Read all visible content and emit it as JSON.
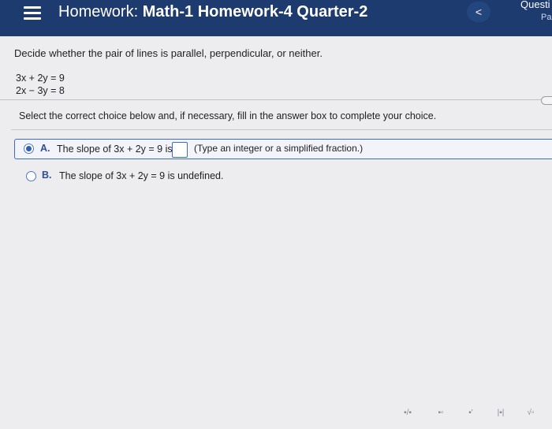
{
  "header": {
    "title_prefix": "Homework: ",
    "title_bold": "Math-1 Homework-4 Quarter-2",
    "back_label": "<",
    "question_label": "Questi",
    "question_sub": "Pa"
  },
  "problem": {
    "prompt": "Decide whether the pair of lines is parallel, perpendicular, or neither.",
    "equations": [
      "3x + 2y = 9",
      "2x − 3y = 8"
    ],
    "instruction": "Select the correct choice below and, if necessary, fill in the answer box to complete your choice."
  },
  "choices": [
    {
      "letter": "A.",
      "text": "The slope of 3x + 2y = 9 is",
      "hint": "(Type an integer or a simplified fraction.)",
      "selected": true,
      "answer_value": ""
    },
    {
      "letter": "B.",
      "text": "The slope of 3x + 2y = 9 is undefined.",
      "selected": false
    }
  ],
  "toolbar": {
    "tools": [
      "fraction-tool",
      "mixed-number-tool",
      "exponent-tool",
      "absolute-value-tool",
      "square-root-tool"
    ],
    "labels": [
      "▪/▪",
      "▪▫",
      "▪'",
      "|▪|",
      "√▫"
    ]
  },
  "colors": {
    "header_bg": "#1d3b6e",
    "accent": "#3d6cc4",
    "panel_bg": "#ededef"
  }
}
